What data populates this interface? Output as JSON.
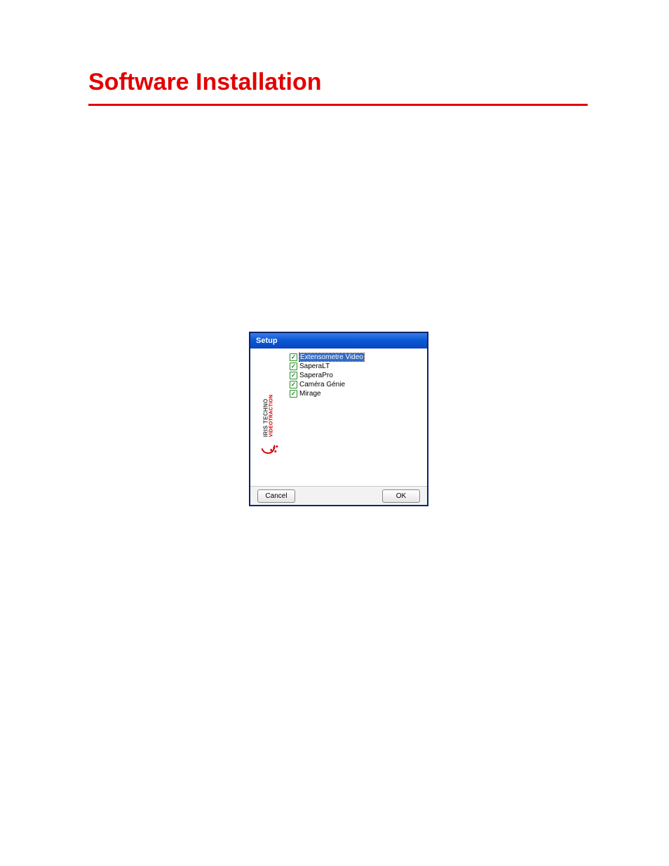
{
  "page": {
    "title": "Software Installation"
  },
  "dialog": {
    "title": "Setup",
    "logo": {
      "line1": "IRIS TECHNO",
      "line2": "VIDEOTRACTION"
    },
    "items": [
      {
        "label": "Extensometre Video",
        "selected": true
      },
      {
        "label": "SaperaLT",
        "selected": false
      },
      {
        "label": "SaperaPro",
        "selected": false
      },
      {
        "label": "Caméra Génie",
        "selected": false
      },
      {
        "label": "Mirage",
        "selected": false
      }
    ],
    "buttons": {
      "cancel": "Cancel",
      "ok": "OK"
    }
  }
}
